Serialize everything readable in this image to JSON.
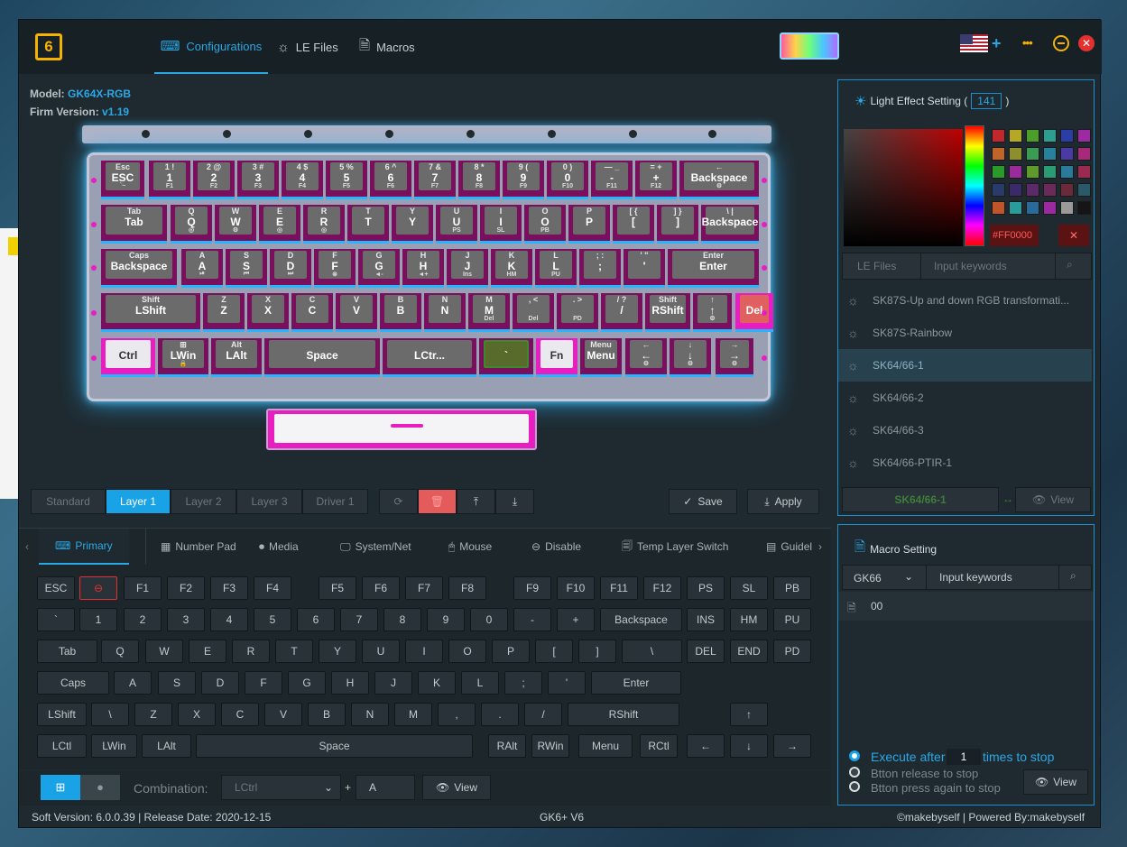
{
  "app": {
    "nav": [
      {
        "label": "Configurations",
        "icon": "keyboard-icon"
      },
      {
        "label": "LE Files",
        "icon": "sun-icon"
      },
      {
        "label": "Macros",
        "icon": "document-icon"
      }
    ],
    "lang_plus": "+",
    "more": "•••"
  },
  "model": {
    "label": "Model:",
    "value": "GK64X-RGB",
    "firm_label": "Firm Version:",
    "firm_value": "v1.19"
  },
  "keyboard": {
    "rows": [
      [
        {
          "s": "Esc",
          "m": "ESC",
          "f": "`~"
        },
        {
          "s": "1 !",
          "m": "1",
          "f": "F1"
        },
        {
          "s": "2 @",
          "m": "2",
          "f": "F2"
        },
        {
          "s": "3 #",
          "m": "3",
          "f": "F3"
        },
        {
          "s": "4 $",
          "m": "4",
          "f": "F4"
        },
        {
          "s": "5 %",
          "m": "5",
          "f": "F5"
        },
        {
          "s": "6 ^",
          "m": "6",
          "f": "F6"
        },
        {
          "s": "7 &",
          "m": "7",
          "f": "F7"
        },
        {
          "s": "8 *",
          "m": "8",
          "f": "F8"
        },
        {
          "s": "9 (",
          "m": "9",
          "f": "F9"
        },
        {
          "s": "0 )",
          "m": "0",
          "f": "F10"
        },
        {
          "s": "— _",
          "m": "-",
          "f": "F11"
        },
        {
          "s": "= +",
          "m": "+",
          "f": "F12"
        },
        {
          "s": "←",
          "m": "Backspace",
          "f": "⚙"
        }
      ],
      [
        {
          "s": "Tab",
          "m": "Tab",
          "f": ""
        },
        {
          "s": "Q",
          "m": "Q",
          "f": "◎"
        },
        {
          "s": "W",
          "m": "W",
          "f": "⚙"
        },
        {
          "s": "E",
          "m": "E",
          "f": "◎"
        },
        {
          "s": "R",
          "m": "R",
          "f": "◎"
        },
        {
          "s": "T",
          "m": "T",
          "f": ""
        },
        {
          "s": "Y",
          "m": "Y",
          "f": ""
        },
        {
          "s": "U",
          "m": "U",
          "f": "PS"
        },
        {
          "s": "I",
          "m": "I",
          "f": "SL"
        },
        {
          "s": "O",
          "m": "O",
          "f": "PB"
        },
        {
          "s": "P",
          "m": "P",
          "f": ""
        },
        {
          "s": "[ {",
          "m": "[",
          "f": ""
        },
        {
          "s": "] }",
          "m": "]",
          "f": ""
        },
        {
          "s": "\\ |",
          "m": "Backspace",
          "f": ""
        }
      ],
      [
        {
          "s": "Caps",
          "m": "Backspace",
          "f": ""
        },
        {
          "s": "A",
          "m": "A",
          "f": "⏯"
        },
        {
          "s": "S",
          "m": "S",
          "f": "⏮"
        },
        {
          "s": "D",
          "m": "D",
          "f": "⏭"
        },
        {
          "s": "F",
          "m": "F",
          "f": "⊗"
        },
        {
          "s": "G",
          "m": "G",
          "f": "◄-"
        },
        {
          "s": "H",
          "m": "H",
          "f": "◄+"
        },
        {
          "s": "J",
          "m": "J",
          "f": "Ins"
        },
        {
          "s": "K",
          "m": "K",
          "f": "HM"
        },
        {
          "s": "L",
          "m": "L",
          "f": "PU"
        },
        {
          "s": "; :",
          "m": ";",
          "f": ""
        },
        {
          "s": "' \"",
          "m": "'",
          "f": ""
        },
        {
          "s": "Enter",
          "m": "Enter",
          "f": ""
        }
      ],
      [
        {
          "s": "Shift",
          "m": "LShift",
          "f": ""
        },
        {
          "s": "Z",
          "m": "Z",
          "f": ""
        },
        {
          "s": "X",
          "m": "X",
          "f": ""
        },
        {
          "s": "C",
          "m": "C",
          "f": ""
        },
        {
          "s": "V",
          "m": "V",
          "f": ""
        },
        {
          "s": "B",
          "m": "B",
          "f": ""
        },
        {
          "s": "N",
          "m": "N",
          "f": ""
        },
        {
          "s": "M",
          "m": "M",
          "f": "Del"
        },
        {
          "s": ", <",
          "m": "",
          "f": "Del"
        },
        {
          "s": ". >",
          "m": "",
          "f": "PD"
        },
        {
          "s": "/ ?",
          "m": "/",
          "f": ""
        },
        {
          "s": "Shift",
          "m": "RShift",
          "f": ""
        },
        {
          "s": "↑",
          "m": "↑",
          "f": "⚙"
        },
        {
          "s": "",
          "m": "Del",
          "f": ""
        }
      ],
      [
        {
          "s": "",
          "m": "Ctrl",
          "f": ""
        },
        {
          "s": "⊞",
          "m": "LWin",
          "f": "🔒"
        },
        {
          "s": "Alt",
          "m": "LAlt",
          "f": ""
        },
        {
          "s": "",
          "m": "Space",
          "f": ""
        },
        {
          "s": "",
          "m": "LCtr...",
          "f": ""
        },
        {
          "s": "",
          "m": "`",
          "f": ""
        },
        {
          "s": "",
          "m": "Fn",
          "f": ""
        },
        {
          "s": "Menu",
          "m": "Menu",
          "f": ""
        },
        {
          "s": "←",
          "m": "←",
          "f": "⚙"
        },
        {
          "s": "↓",
          "m": "↓",
          "f": "⚙"
        },
        {
          "s": "→",
          "m": "→",
          "f": "⚙"
        }
      ]
    ]
  },
  "layers": {
    "tabs": [
      "Standard",
      "Layer 1",
      "Layer 2",
      "Layer 3",
      "Driver 1"
    ],
    "active": "Layer 1",
    "save": "Save",
    "apply": "Apply"
  },
  "keytabs": [
    "Primary",
    "Number Pad",
    "Media",
    "System/Net",
    "Mouse",
    "Disable",
    "Temp Layer Switch",
    "Guidel"
  ],
  "keygrid": {
    "row1": [
      "ESC",
      "⊖",
      "F1",
      "F2",
      "F3",
      "F4",
      "F5",
      "F6",
      "F7",
      "F8",
      "F9",
      "F10",
      "F11",
      "F12",
      "PS",
      "SL",
      "PB"
    ],
    "row2": [
      "`",
      "1",
      "2",
      "3",
      "4",
      "5",
      "6",
      "7",
      "8",
      "9",
      "0",
      "-",
      "+",
      "Backspace",
      "INS",
      "HM",
      "PU"
    ],
    "row3": [
      "Tab",
      "Q",
      "W",
      "E",
      "R",
      "T",
      "Y",
      "U",
      "I",
      "O",
      "P",
      "[",
      "]",
      "\\",
      "DEL",
      "END",
      "PD"
    ],
    "row4": [
      "Caps",
      "A",
      "S",
      "D",
      "F",
      "G",
      "H",
      "J",
      "K",
      "L",
      ";",
      "'",
      "Enter"
    ],
    "row5": [
      "LShift",
      "\\",
      "Z",
      "X",
      "C",
      "V",
      "B",
      "N",
      "M",
      ",",
      ".",
      "/",
      "RShift",
      "↑"
    ],
    "row6": [
      "LCtl",
      "LWin",
      "LAlt",
      "Space",
      "RAlt",
      "RWin",
      "Menu",
      "RCtl",
      "←",
      "↓",
      "→"
    ]
  },
  "combination": {
    "label": "Combination:",
    "select": "LCtrl",
    "plus": "+",
    "key": "A",
    "view": "View"
  },
  "footer": {
    "left": "Soft Version: 6.0.0.39 |  Release Date: 2020-12-15",
    "center": "GK6+ V6",
    "right": "©makebyself |  Powered By:makebyself"
  },
  "light": {
    "title": "Light Effect Setting (",
    "count": "141",
    "close": ")",
    "hex": "#FF0000",
    "swatches": [
      "#c0282d",
      "#b5a825",
      "#4b9e2a",
      "#2e9f8e",
      "#2a3ea6",
      "#9b2aa3",
      "#c0642a",
      "#8c8f2a",
      "#3a9b55",
      "#27819c",
      "#4a3aa6",
      "#a62a79",
      "#2a9b2a",
      "#9b2a9b",
      "#5f9b2a",
      "#2a9b74",
      "#2a7a9b",
      "#9b2a50",
      "#283b6a",
      "#3a2a6a",
      "#5a2a6a",
      "#6a2a5a",
      "#6a2a3a",
      "#2a5a6a",
      "#c0552a",
      "#2a9b9b",
      "#2a6a9b",
      "#9b2aa0",
      "#9a9a9a",
      "#151515"
    ],
    "le_tab": "LE Files",
    "search_placeholder": "Input keywords",
    "items": [
      "SK87S-Up and down RGB transformati...",
      "SK87S-Rainbow",
      "SK64/66-1",
      "SK64/66-2",
      "SK64/66-3",
      "SK64/66-PTIR-1"
    ],
    "selected": "SK64/66-1",
    "current": "SK64/66-1",
    "view": "View"
  },
  "macro": {
    "title": "Macro Setting",
    "select": "GK66",
    "search_placeholder": "Input keywords",
    "items": [
      "00"
    ],
    "opt1a": "Execute after",
    "opt1v": "1",
    "opt1b": "times to stop",
    "opt2": "Btton release to stop",
    "opt3": "Btton press again to stop",
    "view": "View"
  }
}
